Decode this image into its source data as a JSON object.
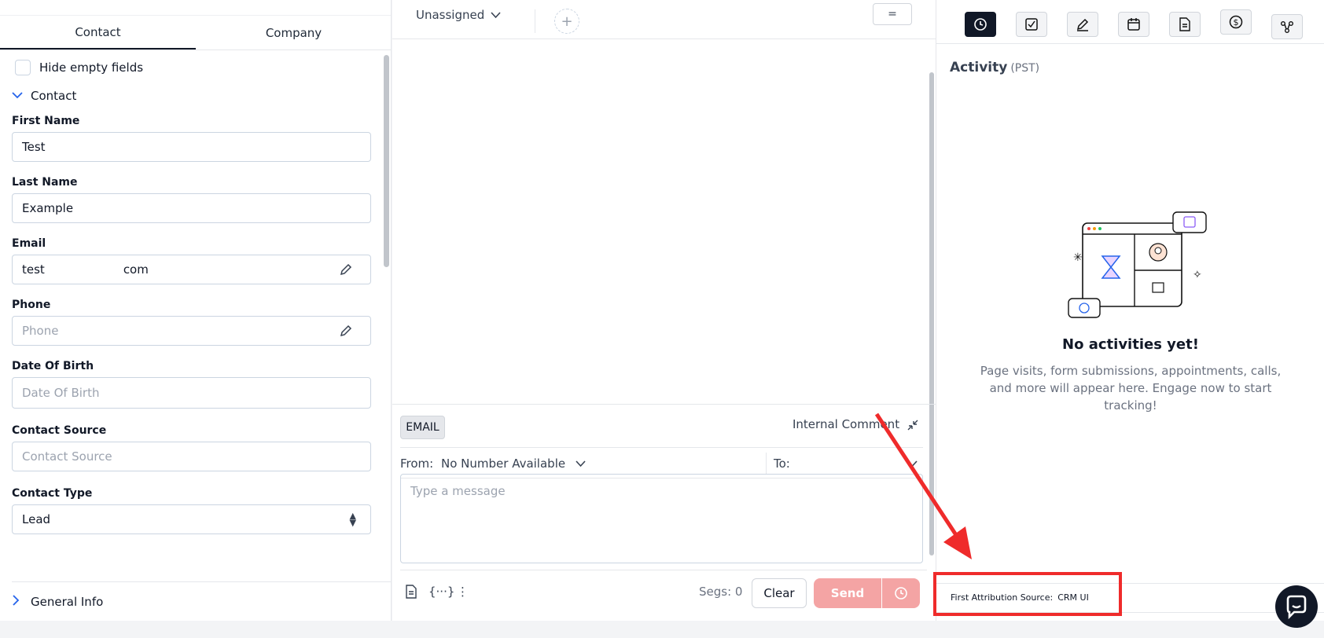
{
  "left": {
    "tabs": [
      "Contact",
      "Company"
    ],
    "hide_empty_label": "Hide empty fields",
    "section_title": "Contact",
    "fields": {
      "first_name": {
        "label": "First Name",
        "value": "Test"
      },
      "last_name": {
        "label": "Last Name",
        "value": "Example"
      },
      "email": {
        "label": "Email",
        "value_prefix": "test",
        "value_suffix": "com"
      },
      "phone": {
        "label": "Phone",
        "placeholder": "Phone"
      },
      "dob": {
        "label": "Date Of Birth",
        "placeholder": "Date Of Birth"
      },
      "source": {
        "label": "Contact Source",
        "placeholder": "Contact Source"
      },
      "type": {
        "label": "Contact Type",
        "value": "Lead"
      }
    },
    "general_info": "General Info"
  },
  "middle": {
    "assign": "Unassigned",
    "plus": "+",
    "filter": "=",
    "composer": {
      "email_tab": "EMAIL",
      "internal_comment": "Internal Comment",
      "from_label": "From:",
      "from_value": "No Number Available",
      "to_label": "To:",
      "message_placeholder": "Type a message",
      "segs": "Segs: 0",
      "clear": "Clear",
      "send": "Send"
    }
  },
  "right": {
    "icons": [
      "activity-icon",
      "task-icon",
      "note-icon",
      "calendar-icon",
      "document-icon",
      "dollar-icon",
      "workflow-icon"
    ],
    "activity_title": "Activity",
    "activity_tz": "(PST)",
    "empty_title": "No activities yet!",
    "empty_text": "Page visits, form submissions, appointments, calls, and more will appear here. Engage now to start tracking!",
    "attribution_label": "First Attribution Source:",
    "attribution_value": "CRM UI"
  },
  "colors": {
    "accent_red": "#ef2b2b",
    "send_disabled": "#f4a4a4",
    "active_icon": "#111827"
  }
}
